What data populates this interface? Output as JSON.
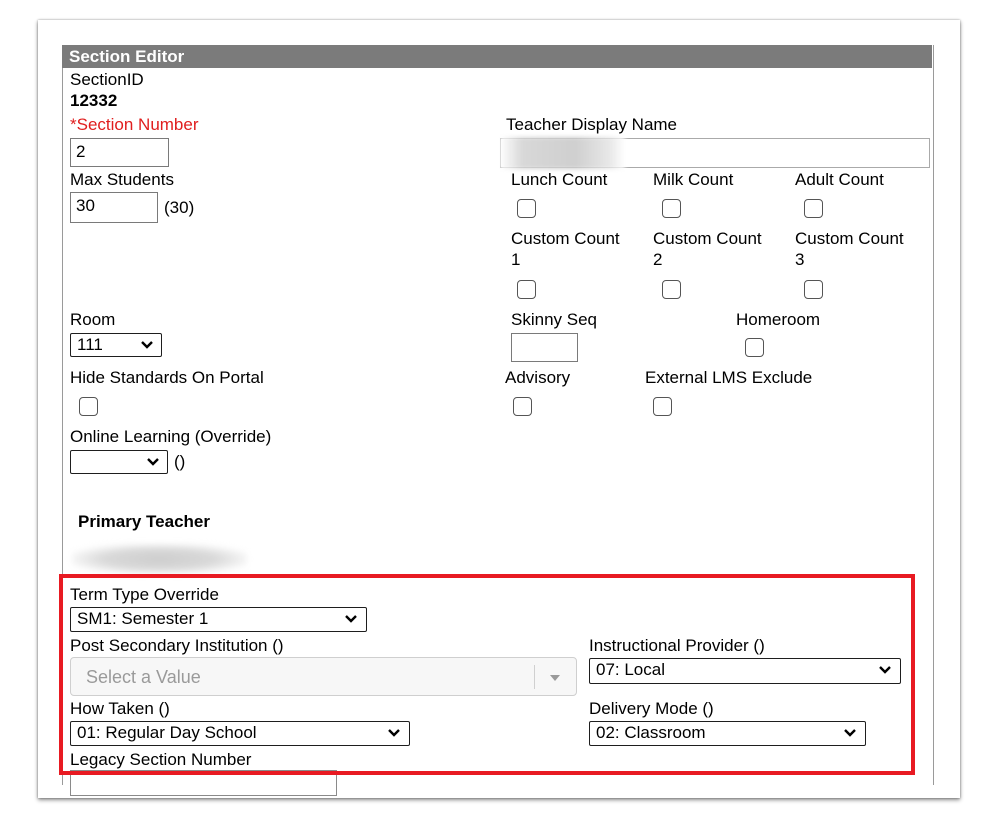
{
  "panel": {
    "title": "Section Editor"
  },
  "section_id": {
    "label": "SectionID",
    "value": "12332"
  },
  "section_number": {
    "label": "*Section Number",
    "value": "2"
  },
  "teacher_display_name": {
    "label": "Teacher Display Name",
    "value": ""
  },
  "max_students": {
    "label": "Max Students",
    "value": "30",
    "note": "(30)"
  },
  "counts": {
    "lunch": "Lunch Count",
    "milk": "Milk Count",
    "adult": "Adult Count",
    "custom1_a": "Custom Count",
    "custom1_b": "1",
    "custom2_a": "Custom Count",
    "custom2_b": "2",
    "custom3_a": "Custom Count",
    "custom3_b": "3"
  },
  "room": {
    "label": "Room",
    "value": "111"
  },
  "skinny_seq": {
    "label": "Skinny Seq",
    "value": ""
  },
  "homeroom": {
    "label": "Homeroom"
  },
  "hide_standards": {
    "label": "Hide Standards On Portal"
  },
  "advisory": {
    "label": "Advisory"
  },
  "external_lms": {
    "label": "External LMS Exclude"
  },
  "online_learning": {
    "label": "Online Learning (Override)",
    "value": "",
    "note": "()"
  },
  "primary_teacher": {
    "label": "Primary Teacher"
  },
  "term_type": {
    "label": "Term Type Override",
    "value": "SM1: Semester 1"
  },
  "post_secondary": {
    "label": "Post Secondary Institution ()",
    "placeholder": "Select a Value"
  },
  "instructional_provider": {
    "label": "Instructional Provider ()",
    "value": "07: Local"
  },
  "how_taken": {
    "label": "How Taken ()",
    "value": "01: Regular Day School"
  },
  "delivery_mode": {
    "label": "Delivery Mode ()",
    "value": "02: Classroom"
  },
  "legacy_section": {
    "label": "Legacy Section Number",
    "value": ""
  },
  "colors": {
    "required": "#e01e1e",
    "header_bg": "#7b7b7b",
    "highlight": "#e81a22"
  }
}
